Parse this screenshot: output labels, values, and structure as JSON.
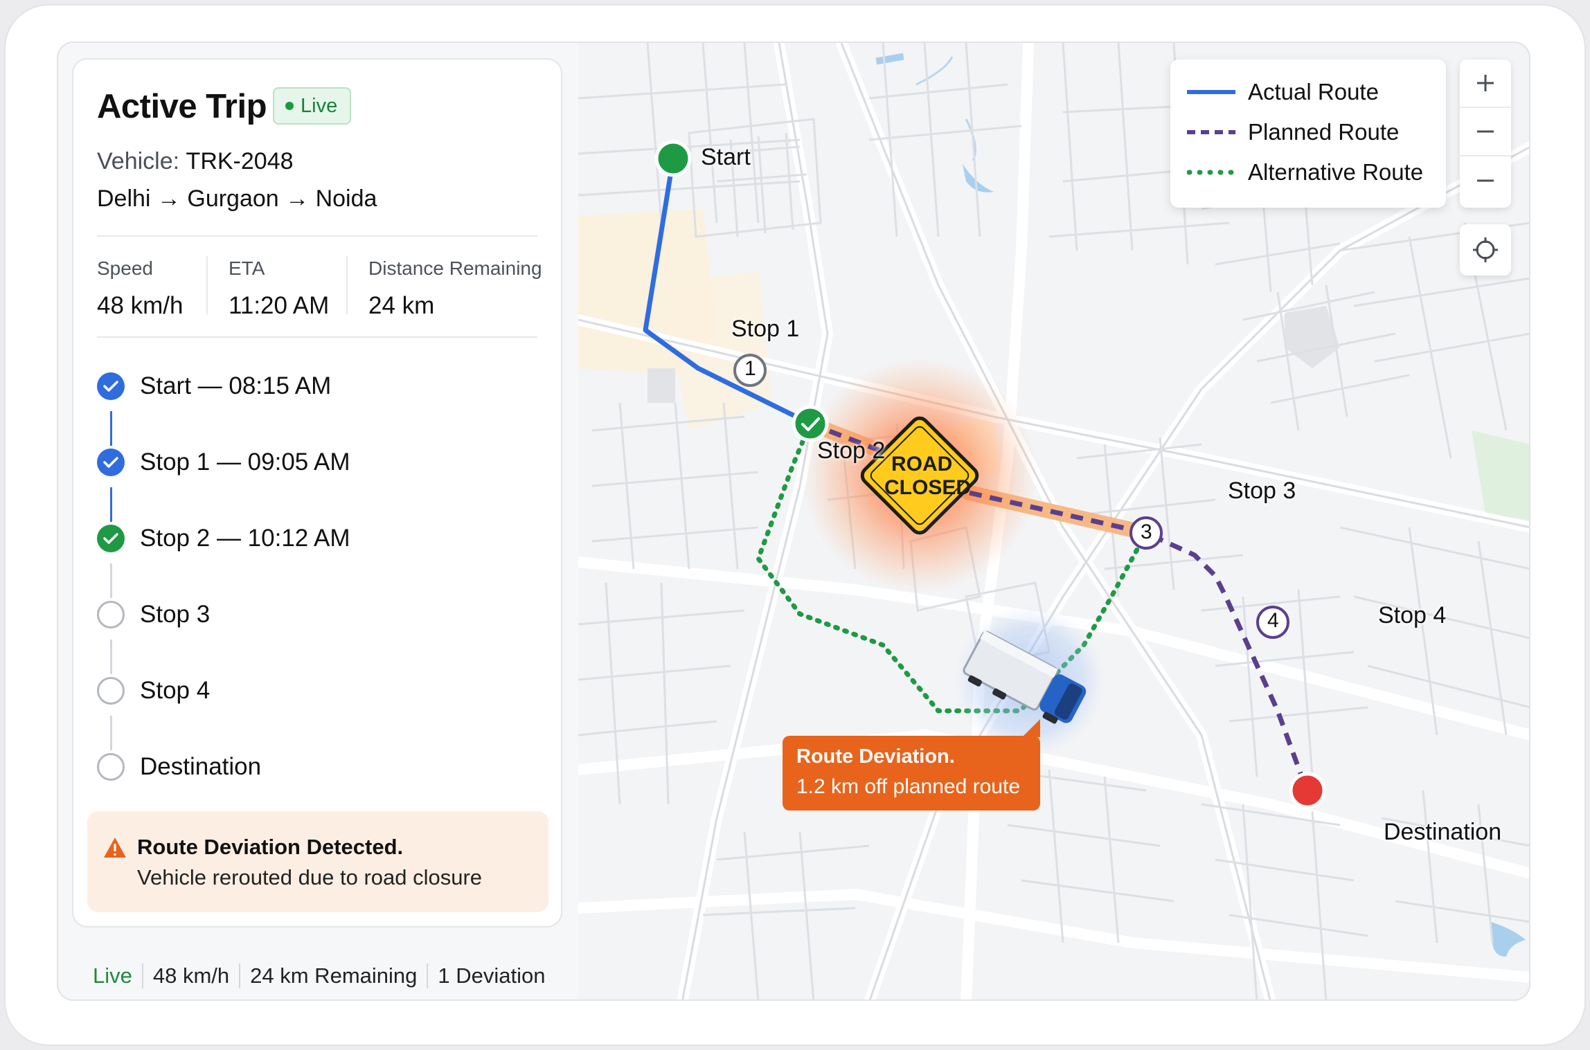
{
  "trip": {
    "title": "Active Trip",
    "status_badge": "Live",
    "vehicle_label": "Vehicle:",
    "vehicle_id": "TRK-2048",
    "route": "Delhi → Gurgaon → Noida"
  },
  "stats": [
    {
      "label": "Speed",
      "value": "48 km/h"
    },
    {
      "label": "ETA",
      "value": "11:20 AM"
    },
    {
      "label": "Distance Remaining",
      "value": "24 km"
    }
  ],
  "timeline": [
    {
      "name": "Start",
      "time": "— 08:15 AM",
      "state": "done"
    },
    {
      "name": "Stop 1",
      "time": "— 09:05 AM",
      "state": "done"
    },
    {
      "name": "Stop 2",
      "time": "— 10:12 AM",
      "state": "done-green"
    },
    {
      "name": "Stop 3",
      "time": "",
      "state": "pending"
    },
    {
      "name": "Stop 4",
      "time": "",
      "state": "pending"
    },
    {
      "name": "Destination",
      "time": "",
      "state": "pending"
    }
  ],
  "alert": {
    "title": "Route Deviation Detected.",
    "message": "Vehicle rerouted due to road closure",
    "icon": "warning-icon"
  },
  "status_bar": {
    "live": "Live",
    "speed": "48 km/h",
    "remaining": "24 km Remaining",
    "deviations": "1 Deviation"
  },
  "legend": [
    {
      "label": "Actual Route",
      "color": "#2f6ddf",
      "style": "solid"
    },
    {
      "label": "Planned Route",
      "color": "#5b3f8f",
      "style": "dashed"
    },
    {
      "label": "Alternative Route",
      "color": "#1f9a44",
      "style": "dotted"
    }
  ],
  "map_labels": {
    "start": "Start",
    "stop1": "Stop 1",
    "stop2": "Stop 2",
    "stop3": "Stop 3",
    "stop4": "Stop 4",
    "destination": "Destination",
    "stop1_num": "1",
    "stop3_num": "3",
    "stop4_num": "4",
    "road_closed_line1": "ROAD",
    "road_closed_line2": "CLOSED"
  },
  "deviation_tooltip": {
    "title": "Route Deviation.",
    "detail": "1.2 km off planned route"
  },
  "map_controls": {
    "zoom_in": "zoom-in-icon",
    "zoom_out": "zoom-out-icon",
    "locate": "crosshair-icon"
  },
  "colors": {
    "actual_route": "#2f6ddf",
    "planned_route": "#5b3f8f",
    "alternative_route": "#1f9a44",
    "closure_highlight": "#f7a25a",
    "deviation_accent": "#e8641c",
    "start_marker": "#1f9a44",
    "destination_marker": "#e53935"
  }
}
